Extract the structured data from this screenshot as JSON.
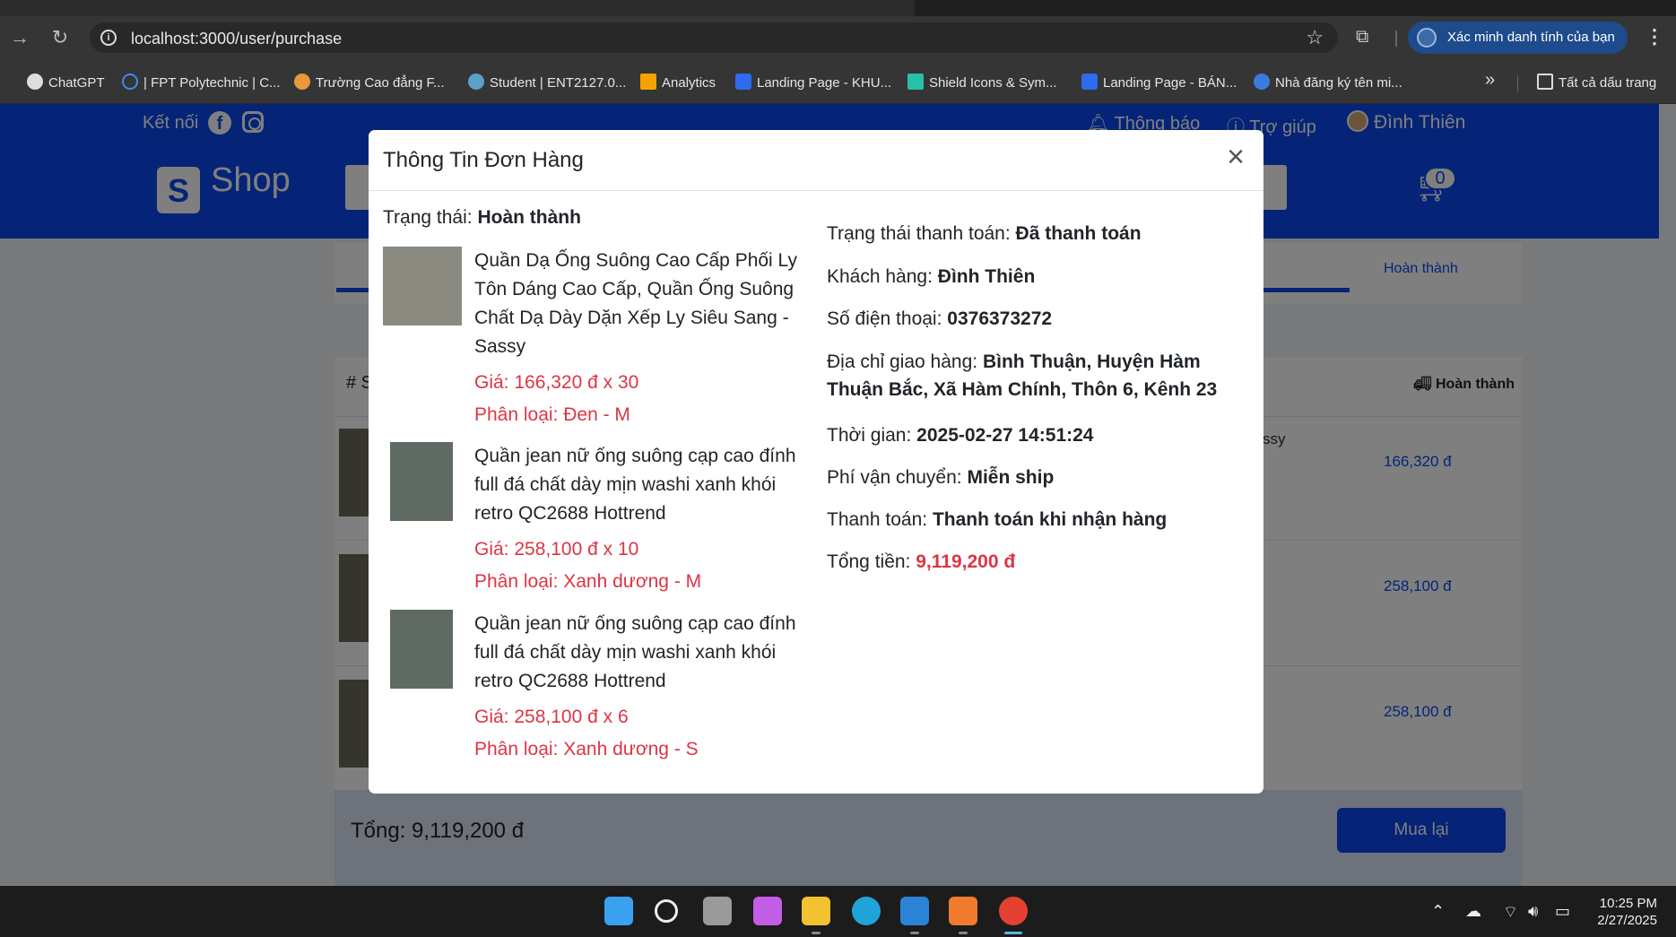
{
  "browser": {
    "url": "localhost:3000/user/purchase",
    "verify_label": "Xác minh danh tính của bạn",
    "bookmarks": [
      {
        "label": "ChatGPT"
      },
      {
        "label": "| FPT Polytechnic | C..."
      },
      {
        "label": "Trường Cao đẳng F..."
      },
      {
        "label": "Student | ENT2127.0..."
      },
      {
        "label": "Analytics"
      },
      {
        "label": "Landing Page - KHU..."
      },
      {
        "label": "Shield Icons & Sym..."
      },
      {
        "label": "Landing Page - BÁN..."
      },
      {
        "label": "Nhà đăng ký tên mi..."
      }
    ],
    "all_bookmarks": "Tất cả dấu trang"
  },
  "header": {
    "connect": "Kết nối",
    "notifications": "Thông báo",
    "help": "Trợ giúp",
    "user": "Đình Thiên",
    "logo": "Shop",
    "cart_count": "0"
  },
  "background": {
    "tab_done": "Hoàn thành",
    "hash": "# S",
    "status_right": "Hoàn thành",
    "fragment": "ssy",
    "prices": [
      "166,320 đ",
      "258,100 đ",
      "258,100 đ"
    ],
    "total": "Tổng: 9,119,200 đ",
    "rebuy": "Mua lại"
  },
  "modal": {
    "title": "Thông Tin Đơn Hàng",
    "status_label": "Trạng thái:",
    "status_value": "Hoàn thành",
    "items": [
      {
        "name": "Quần Dạ Ống Suông Cao Cấp Phối Ly Tôn Dáng Cao Cấp, Quần Ống Suông Chất Dạ Dày Dặn Xếp Ly Siêu Sang -Sassy",
        "price": "Giá: 166,320 đ x 30",
        "variant": "Phân loại: Đen - M"
      },
      {
        "name": "Quần jean nữ ống suông cạp cao đính full đá chất dày mịn washi xanh khói retro QC2688 Hottrend",
        "price": "Giá: 258,100 đ x 10",
        "variant": "Phân loại: Xanh dương - M"
      },
      {
        "name": "Quần jean nữ ống suông cạp cao đính full đá chất dày mịn washi xanh khói retro QC2688 Hottrend",
        "price": "Giá: 258,100 đ x 6",
        "variant": "Phân loại: Xanh dương - S"
      }
    ],
    "details": {
      "payment_status_label": "Trạng thái thanh toán:",
      "payment_status": "Đã thanh toán",
      "customer_label": "Khách hàng:",
      "customer": "Đình Thiên",
      "phone_label": "Số điện thoại:",
      "phone": "0376373272",
      "address_label": "Địa chỉ giao hàng:",
      "address": "Bình Thuận, Huyện Hàm Thuận Bắc, Xã Hàm Chính, Thôn 6, Kênh 23",
      "time_label": "Thời gian:",
      "time": "2025-02-27 14:51:24",
      "shipping_label": "Phí vận chuyển:",
      "shipping": "Miễn ship",
      "payment_label": "Thanh toán:",
      "payment": "Thanh toán khi nhận hàng",
      "total_label": "Tổng tiền:",
      "total": "9,119,200 đ"
    }
  },
  "taskbar": {
    "time": "10:25 PM",
    "date": "2/27/2025"
  }
}
